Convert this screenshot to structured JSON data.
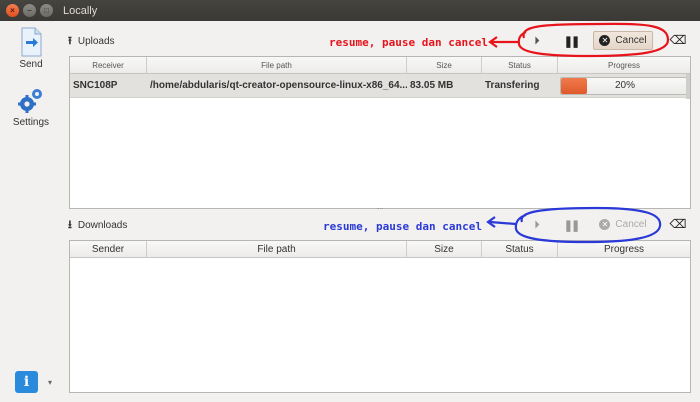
{
  "window": {
    "title": "Locally",
    "close_glyph": "×",
    "min_glyph": "–",
    "max_glyph": "□"
  },
  "sidebar": {
    "send_label": "Send",
    "settings_label": "Settings",
    "info_glyph": "i",
    "info_caret": "▾"
  },
  "uploads": {
    "title": "Uploads",
    "arrow_glyph": "⭱",
    "columns": [
      "Receiver",
      "File path",
      "Size",
      "Status",
      "Progress"
    ],
    "rows": [
      {
        "receiver": "SNC108P",
        "file_path": "/home/abdularis/qt-creator-opensource-linux-x86_64...",
        "size": "83.05 MB",
        "status": "Transfering",
        "progress_text": "20%",
        "progress_value": 20
      }
    ],
    "controls": {
      "resume_glyph": "⏵",
      "pause_glyph": "❚❚",
      "cancel_label": "Cancel",
      "cancel_glyph": "✕",
      "clear_glyph": "⌫"
    }
  },
  "downloads": {
    "title": "Downloads",
    "arrow_glyph": "⭳",
    "columns": [
      "Sender",
      "File path",
      "Size",
      "Status",
      "Progress"
    ],
    "rows": [],
    "controls": {
      "resume_glyph": "⏵",
      "pause_glyph": "❚❚",
      "cancel_label": "Cancel",
      "cancel_glyph": "✕",
      "clear_glyph": "⌫"
    }
  },
  "annotations": {
    "uploads_note": "resume, pause dan cancel",
    "downloads_note": "resume, pause dan cancel",
    "red_color": "#e8141c",
    "blue_color": "#2a39d8"
  },
  "colors": {
    "progress_fill": "#e8602f",
    "selected_row": "#e3e1de",
    "info_button": "#2a8bdc"
  }
}
